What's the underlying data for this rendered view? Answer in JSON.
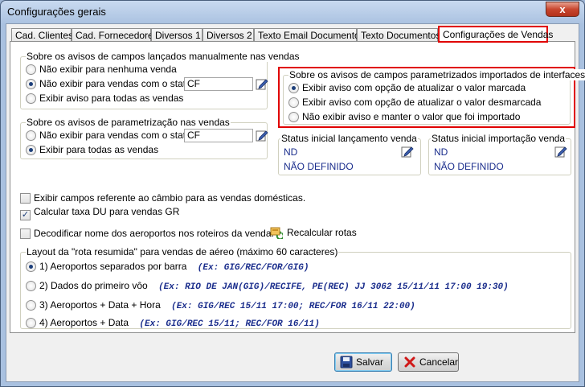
{
  "window": {
    "title": "Configurações gerais",
    "close_glyph": "x"
  },
  "tabs": [
    "Cad. Clientes",
    "Cad. Fornecedores",
    "Diversos 1",
    "Diversos 2",
    "Texto Email Documentos",
    "Texto Documentos",
    "Configurações de Vendas"
  ],
  "active_tab": "Configurações de Vendas",
  "manual_group": {
    "label": "Sobre os avisos de campos lançados manualmente nas vendas",
    "options": [
      "Não exibir para nenhuma venda",
      "Não exibir para vendas com o status",
      "Exibir aviso para todas as vendas"
    ],
    "selected": 1,
    "status_value": "CF"
  },
  "interfaces_group": {
    "label": "Sobre os avisos de campos parametrizados importados de interfaces",
    "options": [
      "Exibir aviso com opção de atualizar o valor marcada",
      "Exibir aviso com opção de atualizar o valor desmarcada",
      "Não exibir aviso e manter o valor que foi importado"
    ],
    "selected": 0
  },
  "param_group": {
    "label": "Sobre os avisos de parametrização nas vendas",
    "options": [
      "Não exibir para vendas com o status",
      "Exibir para todas as vendas"
    ],
    "selected": 1,
    "status_value": "CF"
  },
  "status_launch": {
    "label": "Status inicial lançamento venda",
    "code": "ND",
    "desc": "NÃO DEFINIDO"
  },
  "status_import": {
    "label": "Status inicial importação venda",
    "code": "ND",
    "desc": "NÃO DEFINIDO"
  },
  "checkboxes": [
    {
      "label": "Exibir campos referente ao câmbio para as vendas domésticas.",
      "checked": false
    },
    {
      "label": "Calcular taxa DU para vendas GR",
      "checked": true
    },
    {
      "label": "Decodificar nome dos aeroportos nos roteiros da venda.",
      "checked": false
    }
  ],
  "check_mark": "✓",
  "recalc_label": "Recalcular rotas",
  "route_group": {
    "label": "Layout da \"rota resumida\" para vendas de aéreo (máximo 60 caracteres)",
    "selected": 0,
    "options": [
      {
        "label": "1) Aeroportos separados por barra",
        "example": "(Ex: GIG/REC/FOR/GIG)"
      },
      {
        "label": "2) Dados do primeiro vôo",
        "example": "(Ex: RIO DE JAN(GIG)/RECIFE, PE(REC) JJ 3062 15/11/11 17:00 19:30)"
      },
      {
        "label": "3) Aeroportos + Data + Hora",
        "example": "(Ex: GIG/REC 15/11 17:00; REC/FOR 16/11 22:00)"
      },
      {
        "label": "4) Aeroportos + Data",
        "example": "(Ex: GIG/REC 15/11; REC/FOR 16/11)"
      }
    ]
  },
  "buttons": {
    "save": "Salvar",
    "cancel": "Cancelar"
  },
  "colors": {
    "highlight": "#e00000",
    "value_text": "#1a2d8c"
  },
  "icons": [
    "pencil-icon",
    "recalc-icon",
    "save-icon",
    "cancel-icon",
    "close-icon"
  ]
}
